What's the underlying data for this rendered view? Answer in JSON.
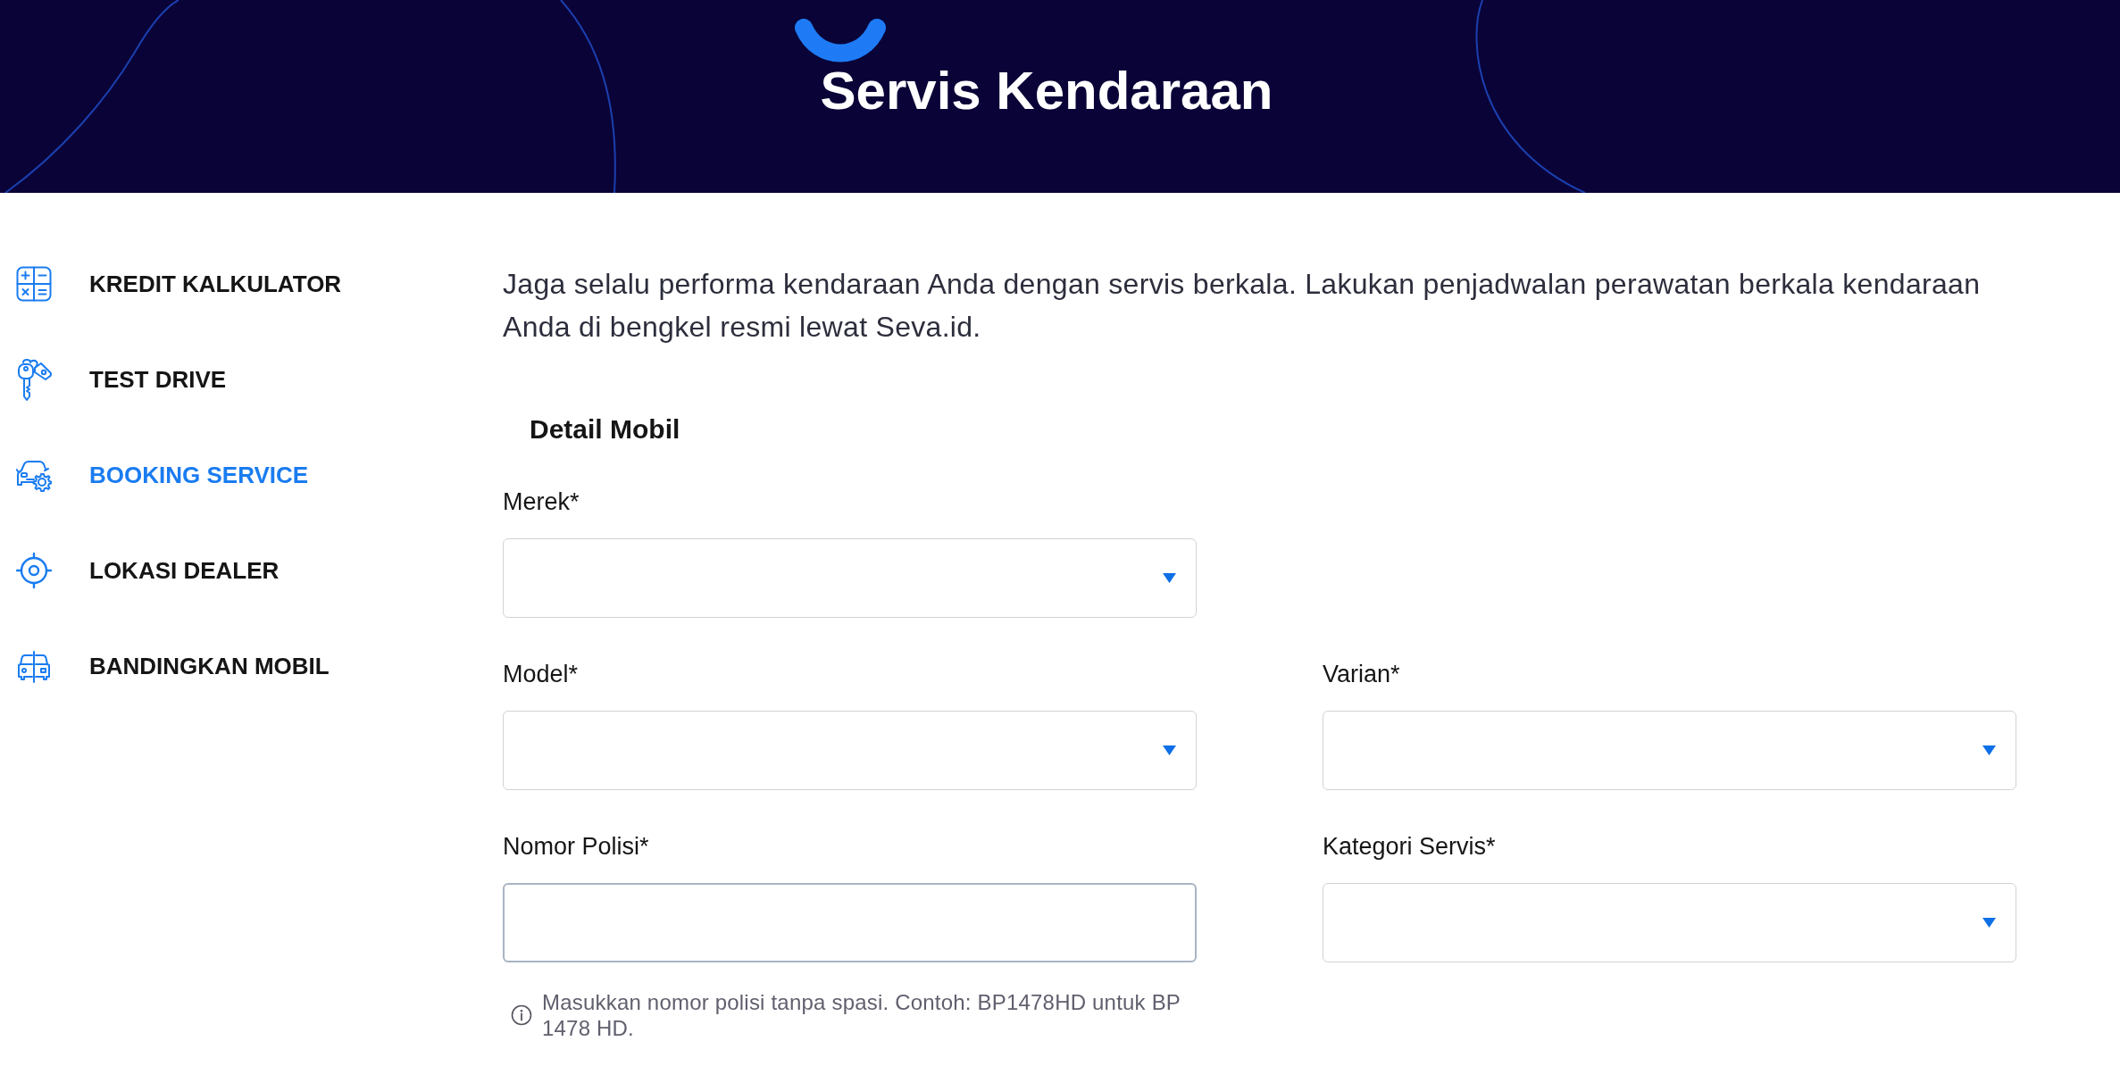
{
  "header": {
    "title": "Servis Kendaraan"
  },
  "sidebar": {
    "items": [
      {
        "label": "KREDIT KALKULATOR",
        "selected": false
      },
      {
        "label": "TEST DRIVE",
        "selected": false
      },
      {
        "label": "BOOKING SERVICE",
        "selected": true
      },
      {
        "label": "LOKASI DEALER",
        "selected": false
      },
      {
        "label": "BANDINGKAN MOBIL",
        "selected": false
      }
    ]
  },
  "intro": "Jaga selalu performa kendaraan Anda dengan servis berkala. Lakukan penjadwalan perawatan berkala kendaraan Anda di bengkel resmi lewat Seva.id.",
  "form": {
    "title": "Detail Mobil",
    "rows": [
      [
        {
          "kind": "select",
          "label": "Merek*"
        }
      ],
      [
        {
          "kind": "select",
          "label": "Model*"
        },
        {
          "kind": "select",
          "label": "Varian*"
        }
      ],
      [
        {
          "kind": "text",
          "label": "Nomor Polisi*",
          "hint": "Masukkan nomor polisi tanpa spasi. Contoh: BP1478HD untuk BP 1478 HD."
        },
        {
          "kind": "select",
          "label": "Kategori Servis*"
        }
      ]
    ]
  }
}
